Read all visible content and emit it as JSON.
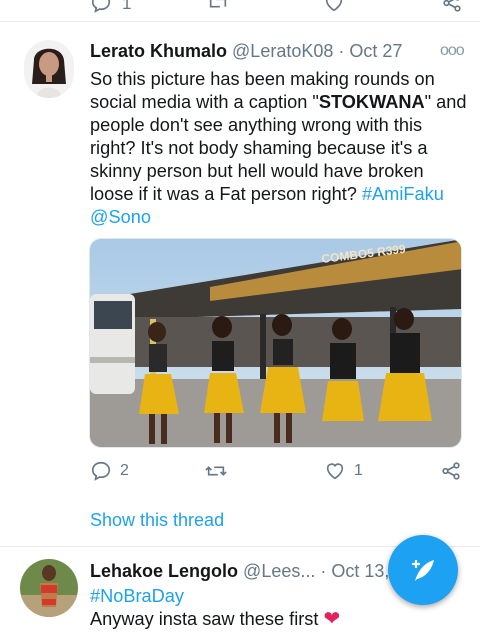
{
  "top_actions": {
    "reply_count": "1"
  },
  "tweet1": {
    "name": "Lerato Khumalo",
    "handle": "@LeratoK08",
    "separator": "·",
    "date": "Oct 27",
    "text_line1": "So this picture has been making rounds on",
    "text_line2_a": "social media with a caption \"",
    "text_line2_bold": "STOKWANA",
    "text_line2_b": "\" and",
    "text_line3": "people don't see anything wrong with this",
    "text_line4": "right? It's not body shaming because it's a",
    "text_line5": "skinny person but hell would have broken",
    "text_line6": "loose if it was a Fat person right? ",
    "hashtag": "#AmiFaku",
    "mention": "@Sono",
    "media_sign": "COMBO5 R399",
    "reply_count": "2",
    "like_count": "1",
    "show_thread": "Show this thread"
  },
  "tweet2": {
    "name": "Lehakoe Lengolo",
    "handle": "@Lees...",
    "separator": "·",
    "date": "Oct 13, 2",
    "hashtag": "#NoBraDay",
    "text": "Anyway insta saw these first "
  },
  "colors": {
    "accent": "#1da1f2",
    "muted": "#657786",
    "heart": "#e0245e"
  }
}
